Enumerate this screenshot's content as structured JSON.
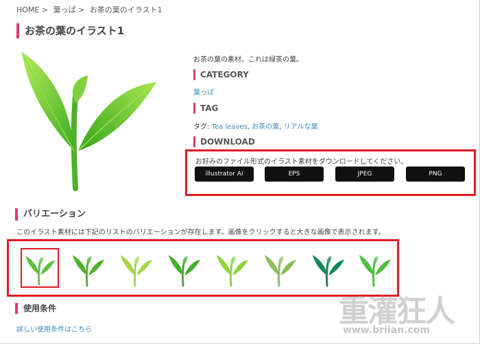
{
  "breadcrumb": {
    "home": "HOME",
    "sep": ">",
    "category": "葉っぱ",
    "current": "お茶の葉のイラスト1"
  },
  "page": {
    "title": "お茶の葉のイラスト1",
    "description": "お茶の葉の素材。これは緑茶の葉。"
  },
  "category": {
    "heading": "CATEGORY",
    "link": "葉っぱ"
  },
  "tags": {
    "heading": "TAG",
    "prefix": "タグ:",
    "items": [
      "Tea leaves",
      "お茶の葉",
      "リアルな葉"
    ]
  },
  "download": {
    "heading": "DOWNLOAD",
    "note": "お好みのファイル形式のイラスト素材をダウンロードしてください。",
    "buttons": [
      "illustrator Ai",
      "EPS",
      "JPEG",
      "PNG"
    ]
  },
  "variations": {
    "heading": "バリエーション",
    "description": "このイラスト素材には下記のリストのバリエーションが存在します。画像をクリックすると大きな画像で表示されます。",
    "thumbnails": [
      {
        "icon": "tea-leaf-icon",
        "color": "#5cc23a",
        "selected": true
      },
      {
        "icon": "tea-leaf-icon",
        "color": "#4cb52c",
        "selected": false
      },
      {
        "icon": "tea-leaf-icon",
        "color": "#a6d84a",
        "selected": false
      },
      {
        "icon": "tea-leaf-icon",
        "color": "#44b030",
        "selected": false
      },
      {
        "icon": "tea-leaf-icon",
        "color": "#8fd43c",
        "selected": false
      },
      {
        "icon": "tea-leaf-icon",
        "color": "#8cc05a",
        "selected": false
      },
      {
        "icon": "tea-leaf-icon",
        "color": "#128a5a",
        "selected": false
      },
      {
        "icon": "tea-leaf-icon",
        "color": "#4ec040",
        "selected": false
      }
    ]
  },
  "terms": {
    "heading": "使用条件",
    "link": "詳しい使用条件はこちら"
  },
  "watermark": {
    "text": "重灌狂人",
    "url": "www.briian.com"
  },
  "colors": {
    "accent": "#e23b6b",
    "highlight": "#e01b24",
    "link": "#3b8bbf",
    "button": "#111111"
  }
}
